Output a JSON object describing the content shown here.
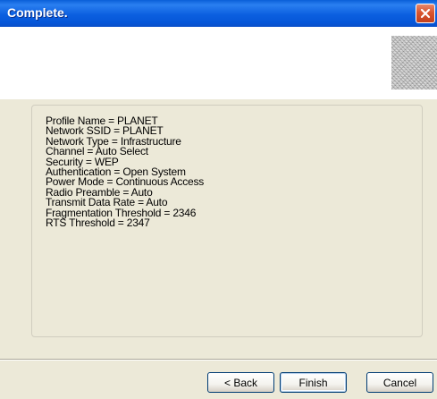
{
  "window": {
    "title": "Complete.",
    "close_icon": "close-icon"
  },
  "header": {
    "graphic": "header-graphic"
  },
  "profile_summary": {
    "lines": [
      "Profile Name = PLANET",
      "Network SSID = PLANET",
      "Network Type = Infrastructure",
      "Channel = Auto Select",
      "Security = WEP",
      "Authentication = Open System",
      "Power Mode = Continuous Access",
      "Radio Preamble = Auto",
      "Transmit Data Rate = Auto",
      "Fragmentation Threshold = 2346",
      "RTS Threshold = 2347"
    ]
  },
  "buttons": {
    "back_label": "< Back",
    "finish_label": "Finish",
    "cancel_label": "Cancel"
  },
  "colors": {
    "titlebar": "#0b5fe0",
    "window_bg": "#ece9d8",
    "close_button": "#d9552f"
  }
}
